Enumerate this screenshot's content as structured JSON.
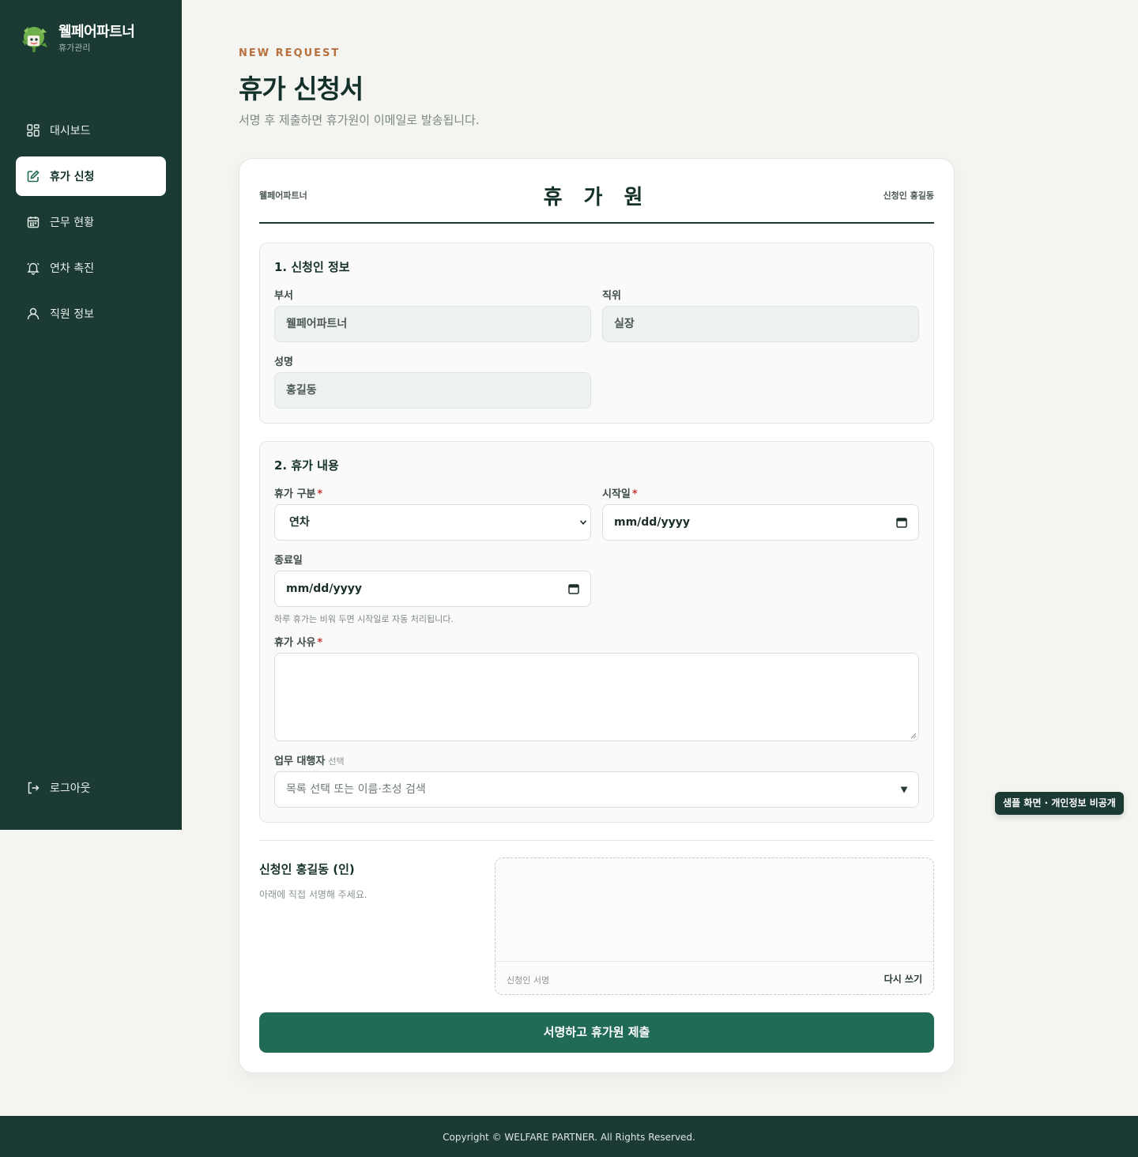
{
  "brand": {
    "name": "웰페어파트너",
    "subtitle": "휴가관리"
  },
  "nav": {
    "items": [
      {
        "label": "대시보드",
        "icon": "dashboard-icon"
      },
      {
        "label": "휴가 신청",
        "icon": "edit-icon",
        "active": true
      },
      {
        "label": "근무 현황",
        "icon": "calendar-icon"
      },
      {
        "label": "연차 촉진",
        "icon": "bell-icon"
      },
      {
        "label": "직원 정보",
        "icon": "user-icon"
      }
    ],
    "logout": "로그아웃"
  },
  "header": {
    "eyebrow": "NEW REQUEST",
    "title": "휴가 신청서",
    "subtitle": "서명 후 제출하면 휴가원이 이메일로 발송됩니다."
  },
  "doc": {
    "org": "웰페어파트너",
    "title": "휴 가 원",
    "applicant": "신청인 홍길동"
  },
  "section1": {
    "title": "1. 신청인 정보",
    "department_label": "부서",
    "department_value": "웰페어파트너",
    "position_label": "직위",
    "position_value": "실장",
    "name_label": "성명",
    "name_value": "홍길동"
  },
  "section2": {
    "title": "2. 휴가 내용",
    "type_label": "휴가 구분",
    "type_value": "연차",
    "start_label": "시작일",
    "start_placeholder": "mm/dd/yyyy",
    "end_label": "종료일",
    "end_placeholder": "mm/dd/yyyy",
    "end_helper": "하루 휴가는 비워 두면 시작일로 자동 처리됩니다.",
    "reason_label": "휴가 사유",
    "reason_value": "",
    "delegate_label": "업무 대행자",
    "delegate_optional": "선택",
    "delegate_placeholder": "목록 선택 또는 이름·초성 검색",
    "required_mark": "*"
  },
  "signature": {
    "title": "신청인 홍길동 (인)",
    "description": "아래에 직접 서명해 주세요.",
    "caption": "신청인 서명",
    "clear_label": "다시 쓰기"
  },
  "submit_label": "서명하고 휴가원 제출",
  "sample_badge": "샘플 화면 · 개인정보 비공개",
  "footer": "Copyright © WELFARE PARTNER. All Rights Reserved.",
  "colors": {
    "sidebar": "#1b3a33",
    "primary": "#206a56",
    "accent": "#b8703e",
    "required": "#c4393b",
    "background": "#f4f5f1"
  }
}
